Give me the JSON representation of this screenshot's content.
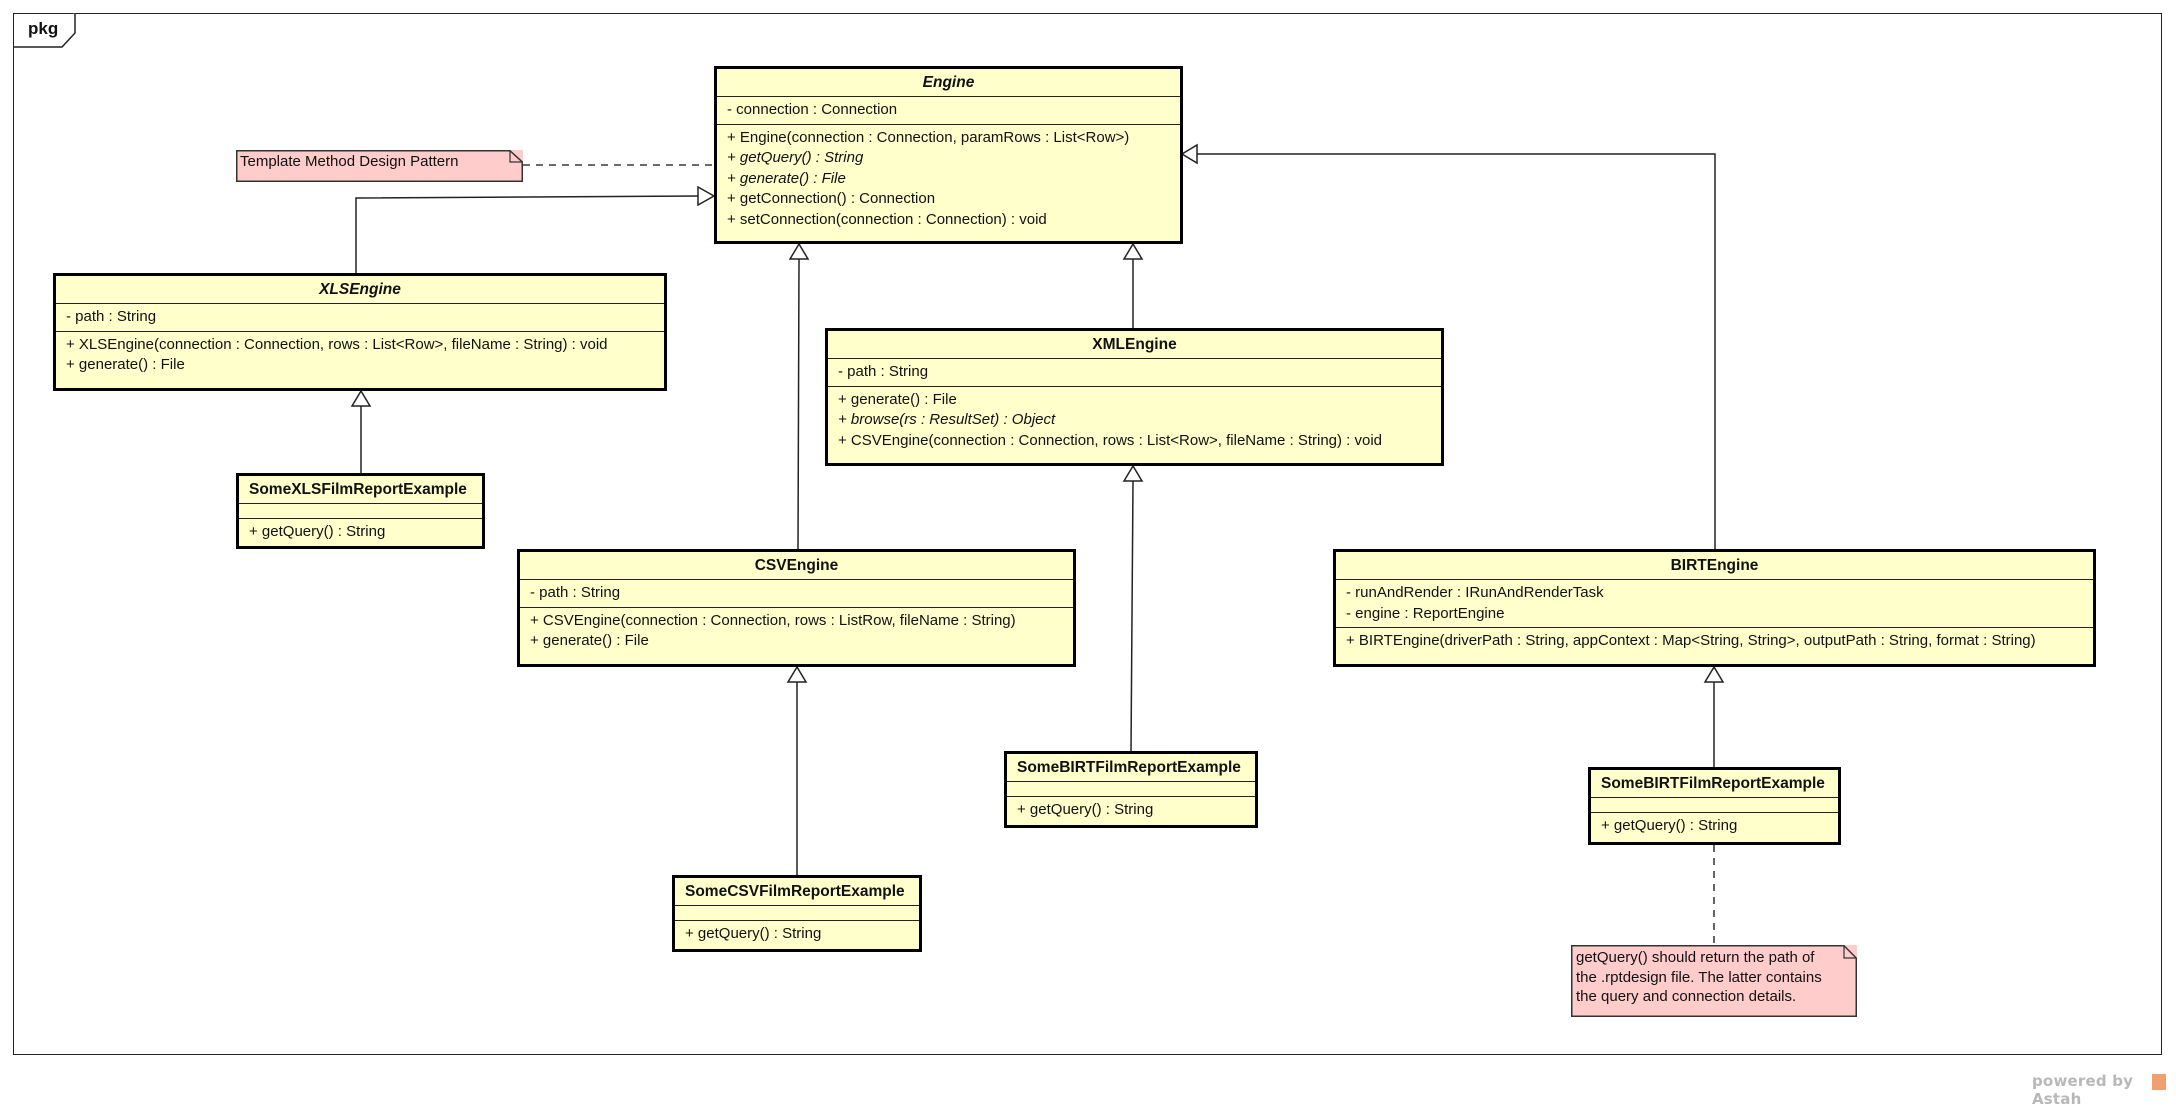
{
  "diagram": {
    "frame_label": "pkg",
    "watermark": "powered by Astah",
    "colors": {
      "class_fill": "#ffffcc",
      "note_fill": "#ffcccc",
      "border": "#000000",
      "watermark": "#b8b8b8"
    }
  },
  "classes": {
    "engine": {
      "name": "Engine",
      "abstract": true,
      "attributes": [
        "- connection : Connection"
      ],
      "operations": [
        {
          "text": "+ Engine(connection : Connection, paramRows : List<Row>)",
          "italic": false
        },
        {
          "text": "+ getQuery() : String",
          "italic": true
        },
        {
          "text": "+ generate() : File",
          "italic": true
        },
        {
          "text": "+ getConnection() : Connection",
          "italic": false
        },
        {
          "text": "+ setConnection(connection : Connection) : void",
          "italic": false
        }
      ]
    },
    "xls_engine": {
      "name": "XLSEngine",
      "abstract": true,
      "attributes": [
        "- path : String"
      ],
      "operations": [
        {
          "text": "+ XLSEngine(connection : Connection, rows : List<Row>, fileName : String) : void",
          "italic": false
        },
        {
          "text": "+ generate() : File",
          "italic": false
        }
      ]
    },
    "xml_engine": {
      "name": "XMLEngine",
      "abstract": false,
      "attributes": [
        "- path : String"
      ],
      "operations": [
        {
          "text": "+ generate() : File",
          "italic": false
        },
        {
          "text": "+ browse(rs : ResultSet) : Object",
          "italic": true
        },
        {
          "text": "+ CSVEngine(connection : Connection, rows : List<Row>, fileName : String) : void",
          "italic": false
        }
      ]
    },
    "csv_engine": {
      "name": "CSVEngine",
      "abstract": false,
      "attributes": [
        "- path : String"
      ],
      "operations": [
        {
          "text": "+ CSVEngine(connection : Connection, rows : ListRow, fileName : String)",
          "italic": false
        },
        {
          "text": "+ generate() : File",
          "italic": false
        }
      ]
    },
    "birt_engine": {
      "name": "BIRTEngine",
      "abstract": false,
      "attributes": [
        "- runAndRender : IRunAndRenderTask",
        "- engine : ReportEngine"
      ],
      "operations": [
        {
          "text": "+ BIRTEngine(driverPath : String, appContext : Map<String, String>, outputPath : String, format : String)",
          "italic": false
        }
      ]
    },
    "some_xls": {
      "name": "SomeXLSFilmReportExample",
      "attributes": [],
      "operations": [
        {
          "text": "+ getQuery() : String",
          "italic": false
        }
      ]
    },
    "some_csv": {
      "name": "SomeCSVFilmReportExample",
      "attributes": [],
      "operations": [
        {
          "text": "+ getQuery() : String",
          "italic": false
        }
      ]
    },
    "some_birt_xml": {
      "name": "SomeBIRTFilmReportExample",
      "attributes": [],
      "operations": [
        {
          "text": "+ getQuery() : String",
          "italic": false
        }
      ]
    },
    "some_birt": {
      "name": "SomeBIRTFilmReportExample",
      "attributes": [],
      "operations": [
        {
          "text": "+ getQuery() : String",
          "italic": false
        }
      ]
    }
  },
  "notes": {
    "template_method": "Template Method Design Pattern",
    "birt_query": "getQuery() should return the path of\nthe .rptdesign file. The latter contains\nthe query and connection details."
  },
  "relationships": [
    {
      "type": "generalization",
      "from": "XLSEngine",
      "to": "Engine"
    },
    {
      "type": "generalization",
      "from": "CSVEngine",
      "to": "Engine"
    },
    {
      "type": "generalization",
      "from": "XMLEngine",
      "to": "Engine"
    },
    {
      "type": "generalization",
      "from": "BIRTEngine",
      "to": "Engine"
    },
    {
      "type": "generalization",
      "from": "SomeXLSFilmReportExample",
      "to": "XLSEngine"
    },
    {
      "type": "generalization",
      "from": "SomeCSVFilmReportExample",
      "to": "CSVEngine"
    },
    {
      "type": "generalization",
      "from": "SomeBIRTFilmReportExample",
      "to": "XMLEngine"
    },
    {
      "type": "generalization",
      "from": "SomeBIRTFilmReportExample",
      "to": "BIRTEngine"
    },
    {
      "type": "note-anchor",
      "from": "Template Method Design Pattern",
      "to": "Engine.getQuery()"
    },
    {
      "type": "note-anchor",
      "from": "getQuery() note",
      "to": "SomeBIRTFilmReportExample"
    }
  ]
}
